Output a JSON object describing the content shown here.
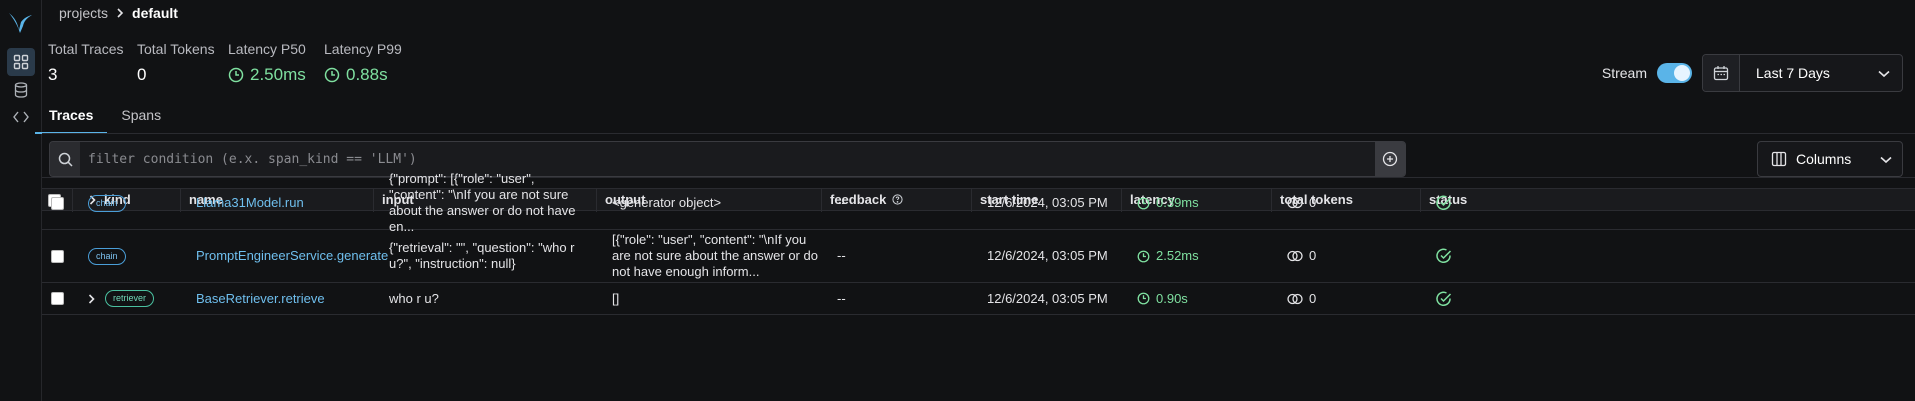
{
  "breadcrumb": {
    "root": "projects",
    "current": "default"
  },
  "stats": [
    {
      "label": "Total Traces",
      "value": "3"
    },
    {
      "label": "Total Tokens",
      "value": "0"
    },
    {
      "label": "Latency P50",
      "value": "2.50ms"
    },
    {
      "label": "Latency P99",
      "value": "0.88s"
    }
  ],
  "stream": {
    "label": "Stream",
    "enabled": true
  },
  "date_range": {
    "value": "Last 7 Days"
  },
  "tabs": [
    {
      "label": "Traces"
    },
    {
      "label": "Spans"
    }
  ],
  "filter": {
    "placeholder": "filter condition (e.x. span_kind == 'LLM')"
  },
  "columns_button": {
    "label": "Columns"
  },
  "table": {
    "headers": {
      "kind": "kind",
      "name": "name",
      "input": "input",
      "output": "output",
      "feedback": "feedback",
      "start_time": "start time",
      "latency": "latency",
      "total_tokens": "total tokens",
      "status": "status"
    },
    "rows": [
      {
        "kind": "chain",
        "name": "Llama31Model.run",
        "input": "{\"prompt\": [{\"role\": \"user\", \"content\": \"\\nIf you are not sure about the answer or do not have en...",
        "output": "<generator object>",
        "feedback": "--",
        "start_time": "12/6/2024, 03:05 PM",
        "latency": "0.39ms",
        "tokens": "0"
      },
      {
        "kind": "chain",
        "name": "PromptEngineerService.generate",
        "input": "{\"retrieval\": \"\", \"question\": \"who r u?\", \"instruction\": null}",
        "output": "[{\"role\": \"user\", \"content\": \"\\nIf you are not sure about the answer or do not have enough inform...",
        "feedback": "--",
        "start_time": "12/6/2024, 03:05 PM",
        "latency": "2.52ms",
        "tokens": "0"
      },
      {
        "kind": "retriever",
        "name": "BaseRetriever.retrieve",
        "input": "who r u?",
        "output": "[]",
        "feedback": "--",
        "start_time": "12/6/2024, 03:05 PM",
        "latency": "0.90s",
        "tokens": "0"
      }
    ]
  },
  "colors": {
    "accent": "#5ab4e8",
    "latency_green": "#7fe0a0",
    "background": "#111214"
  }
}
